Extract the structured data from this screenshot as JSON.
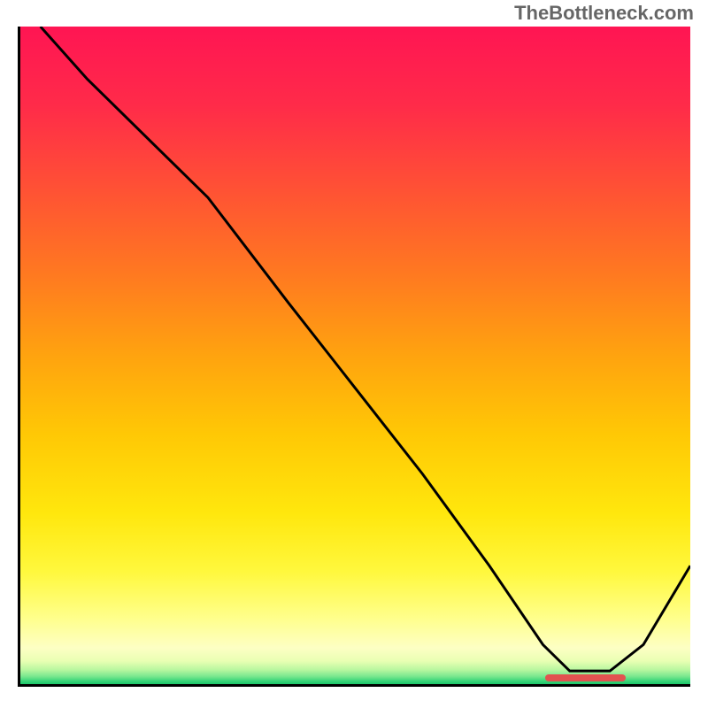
{
  "watermark": "TheBottleneck.com",
  "chart_data": {
    "type": "line",
    "title": "",
    "xlabel": "",
    "ylabel": "",
    "xlim": [
      0,
      100
    ],
    "ylim": [
      0,
      100
    ],
    "grid": false,
    "legend": false,
    "series": [
      {
        "name": "curve",
        "x": [
          3,
          10,
          20,
          28,
          40,
          50,
          60,
          70,
          78,
          82,
          88,
          93,
          100
        ],
        "values": [
          100,
          92,
          82,
          74,
          58,
          45,
          32,
          18,
          6,
          2,
          2,
          6,
          18
        ]
      }
    ],
    "gradient_stops": [
      {
        "pos": 0.0,
        "color": "#ff1553"
      },
      {
        "pos": 0.12,
        "color": "#ff2b49"
      },
      {
        "pos": 0.25,
        "color": "#ff5234"
      },
      {
        "pos": 0.38,
        "color": "#ff7a20"
      },
      {
        "pos": 0.5,
        "color": "#ffa30f"
      },
      {
        "pos": 0.62,
        "color": "#ffc805"
      },
      {
        "pos": 0.74,
        "color": "#ffe70d"
      },
      {
        "pos": 0.83,
        "color": "#fff83e"
      },
      {
        "pos": 0.9,
        "color": "#ffff8c"
      },
      {
        "pos": 0.945,
        "color": "#fdffc4"
      },
      {
        "pos": 0.965,
        "color": "#e9ffb3"
      },
      {
        "pos": 0.978,
        "color": "#b9f7a0"
      },
      {
        "pos": 0.988,
        "color": "#7be88f"
      },
      {
        "pos": 0.995,
        "color": "#3dd57a"
      },
      {
        "pos": 1.0,
        "color": "#1bc76a"
      }
    ],
    "red_marker": {
      "x_start": 78,
      "x_end": 90,
      "y": 0.5
    }
  }
}
